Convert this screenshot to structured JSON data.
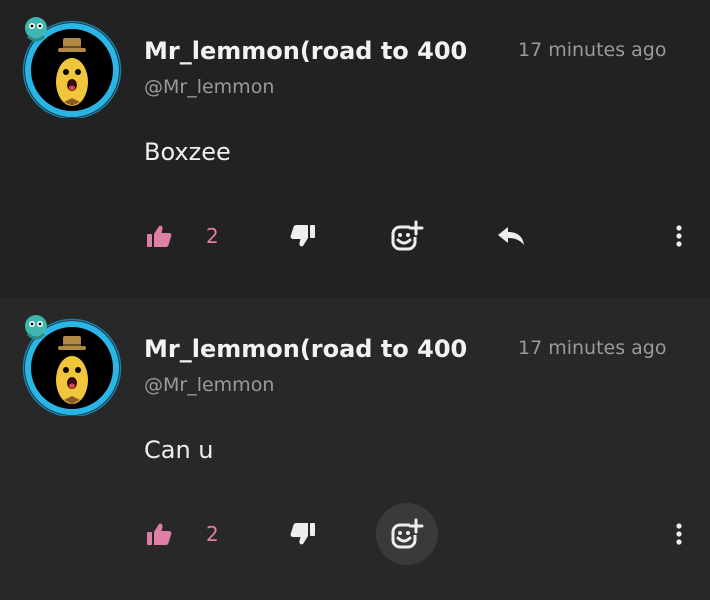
{
  "comments": [
    {
      "display_name": "Mr_lemmon(road to 400",
      "handle": "@Mr_lemmon",
      "time": "17 minutes ago",
      "text": "Boxzee",
      "likes": "2",
      "show_reply": true,
      "react_hovered": false
    },
    {
      "display_name": "Mr_lemmon(road to 400",
      "handle": "@Mr_lemmon",
      "time": "17 minutes ago",
      "text": "Can u",
      "likes": "2",
      "show_reply": false,
      "react_hovered": true
    }
  ],
  "colors": {
    "like_accent": "#e07fa6",
    "avatar_ring": "#29b6e6",
    "text_primary": "#f2f2f2",
    "text_muted": "#9a9a9a",
    "background": "#222222"
  },
  "icons": {
    "like": "thumbs-up-icon",
    "dislike": "thumbs-down-icon",
    "react": "add-reaction-icon",
    "reply": "reply-icon",
    "more": "more-vertical-icon"
  }
}
